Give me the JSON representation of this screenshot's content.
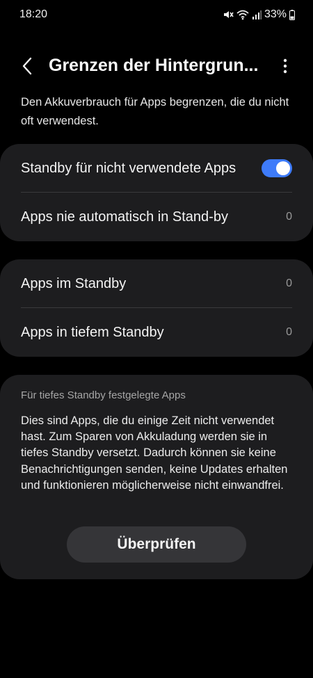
{
  "status_bar": {
    "time": "18:20",
    "battery_percent": "33%",
    "icons": [
      "mute-icon",
      "wifi-icon",
      "signal-icon",
      "battery-icon"
    ]
  },
  "header": {
    "title": "Grenzen der Hintergrun...",
    "back_icon": "chevron-left-icon",
    "more_icon": "more-vertical-icon"
  },
  "description": "Den Akkuverbrauch für Apps begrenzen, die du nicht oft verwendest.",
  "section1": {
    "standby_toggle": {
      "label": "Standby für nicht verwendete Apps",
      "on": true
    },
    "never_standby": {
      "label": "Apps nie automatisch in Stand-by",
      "count": "0"
    }
  },
  "section2": {
    "in_standby": {
      "label": "Apps im Standby",
      "count": "0"
    },
    "deep_standby": {
      "label": "Apps in tiefem Standby",
      "count": "0"
    }
  },
  "section3": {
    "header": "Für tiefes Standby festgelegte Apps",
    "body": "Dies sind Apps, die du einige Zeit nicht verwendet hast. Zum Sparen von Akkuladung werden sie in tiefes Standby versetzt. Dadurch können sie keine Benachrichtigungen senden, keine Updates erhalten und funktionieren möglicherweise nicht einwandfrei.",
    "button_label": "Überprüfen"
  },
  "colors": {
    "background": "#000000",
    "card": "#1d1d1f",
    "accent": "#3e7bfa",
    "button": "#353538"
  }
}
